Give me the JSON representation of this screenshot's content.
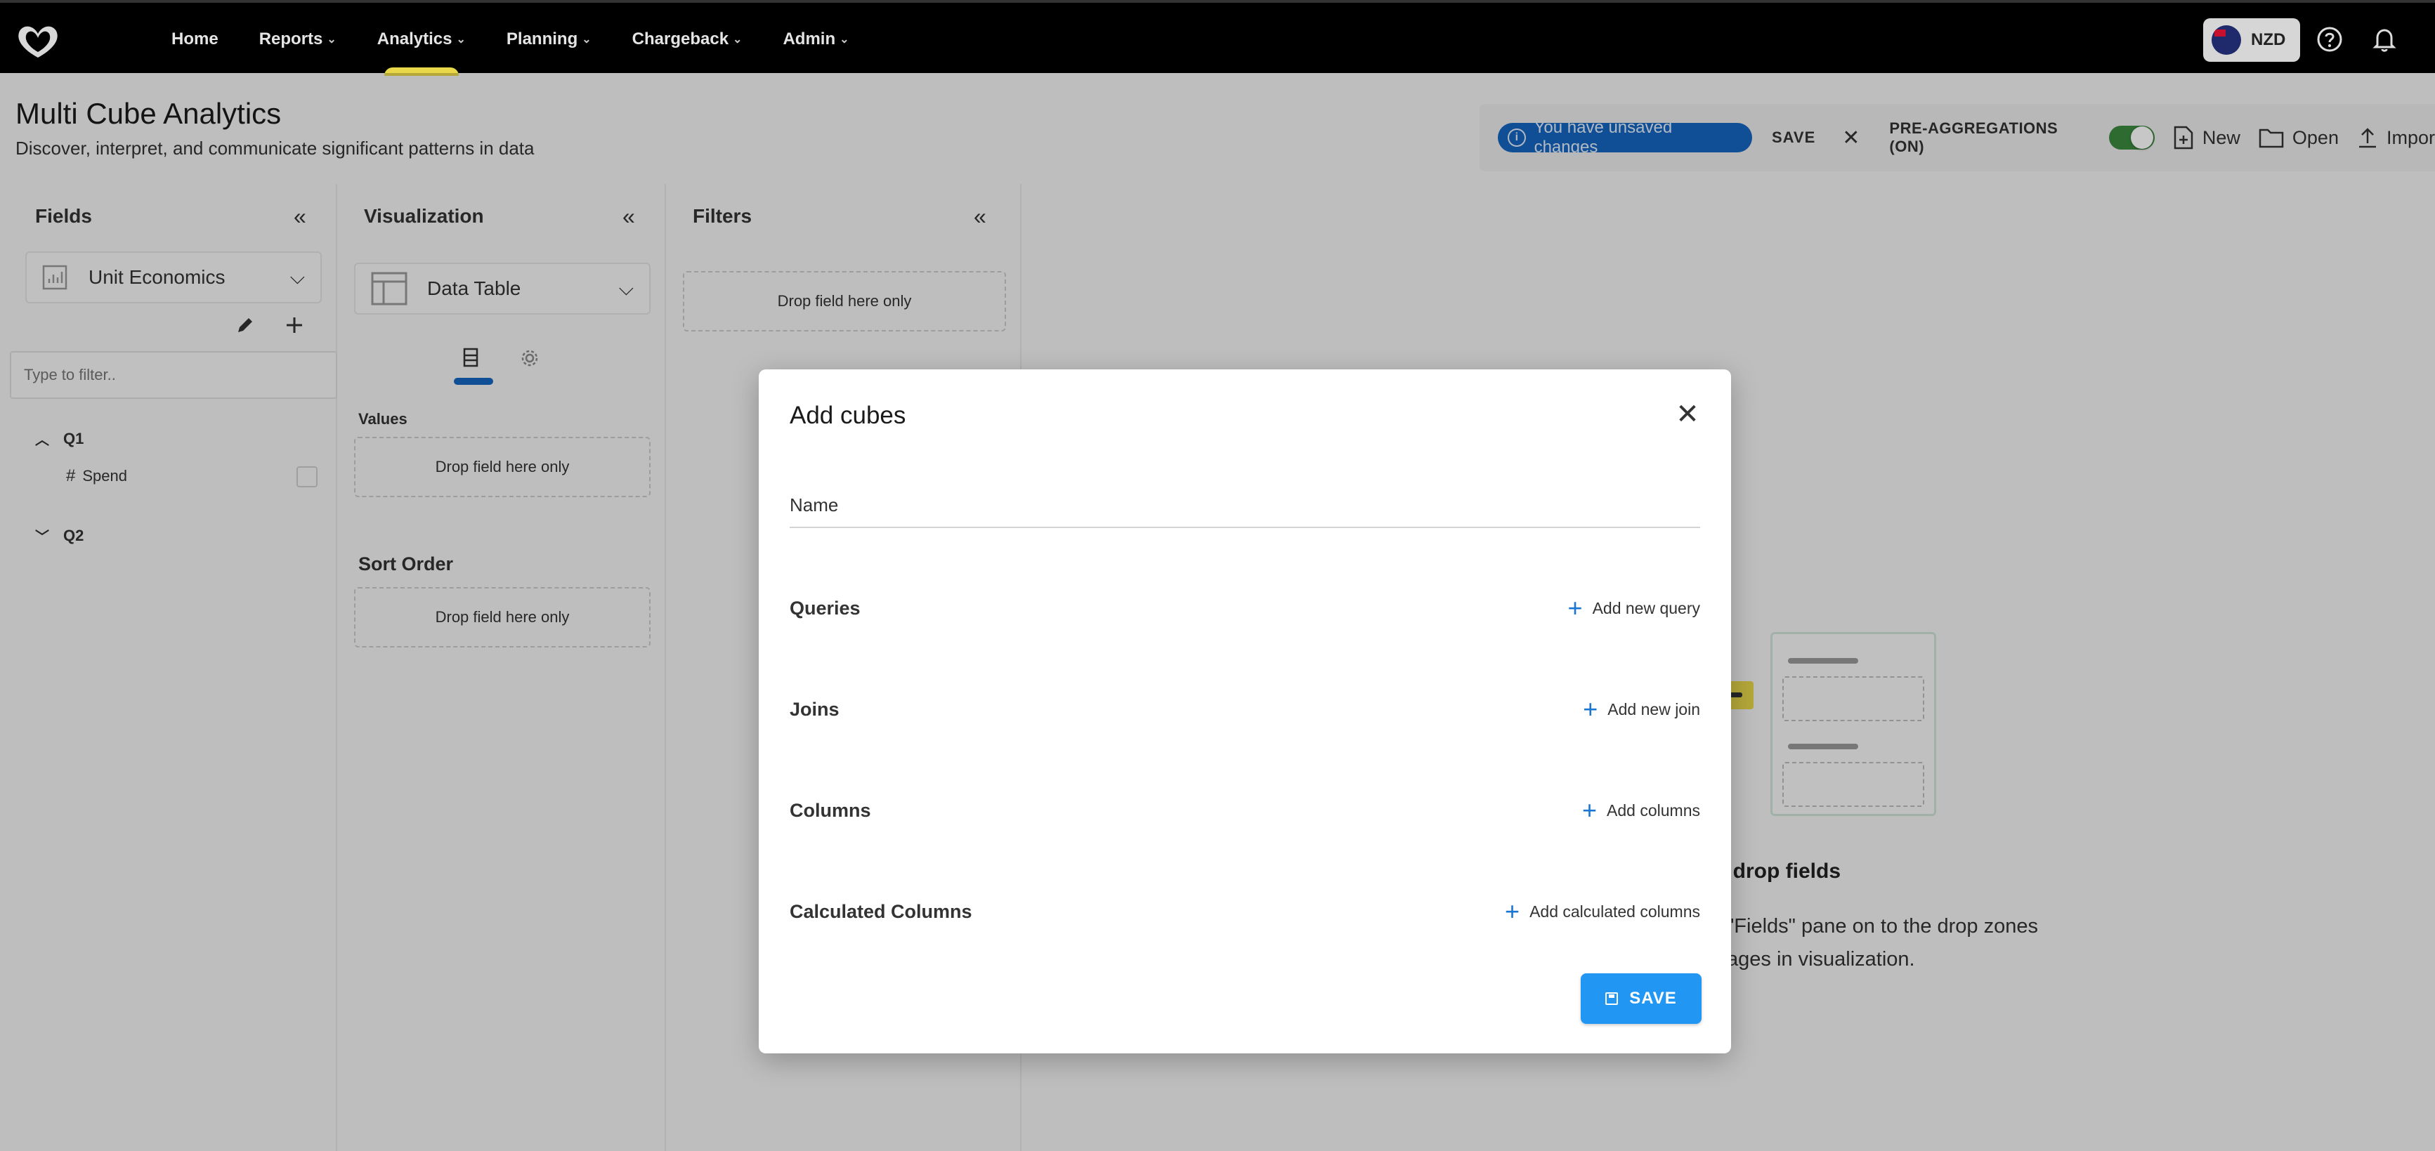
{
  "nav": {
    "items": [
      {
        "label": "Home",
        "has_menu": false,
        "active": false
      },
      {
        "label": "Reports",
        "has_menu": true,
        "active": false
      },
      {
        "label": "Analytics",
        "has_menu": true,
        "active": true
      },
      {
        "label": "Planning",
        "has_menu": true,
        "active": false
      },
      {
        "label": "Chargeback",
        "has_menu": true,
        "active": false
      },
      {
        "label": "Admin",
        "has_menu": true,
        "active": false
      }
    ],
    "currency": "NZD"
  },
  "header": {
    "title": "Multi Cube Analytics",
    "subtitle": "Discover, interpret, and communicate significant patterns in data"
  },
  "actionbar": {
    "unsaved_text": "You have unsaved changes",
    "save_label": "SAVE",
    "preagg_label": "PRE-AGGREGATIONS (ON)",
    "preagg_on": true,
    "new_label": "New",
    "open_label": "Open",
    "import_label": "Impor"
  },
  "fields_panel": {
    "title": "Fields",
    "cube_select": "Unit Economics",
    "filter_placeholder": "Type to filter..",
    "tree": [
      {
        "group": "Q1",
        "expanded": true,
        "fields": [
          {
            "name": "Spend",
            "type": "#"
          }
        ]
      },
      {
        "group": "Q2",
        "expanded": false,
        "fields": []
      }
    ]
  },
  "visualization_panel": {
    "title": "Visualization",
    "type_select": "Data Table",
    "values_label": "Values",
    "values_drop": "Drop field here only",
    "sort_label": "Sort Order",
    "sort_drop": "Drop field here only"
  },
  "filters_panel": {
    "title": "Filters",
    "drop": "Drop field here only"
  },
  "empty_state": {
    "title": "d drop fields",
    "line1": "\"Fields\" pane on to the drop zones",
    "line2": "ages in visualization."
  },
  "modal": {
    "title": "Add cubes",
    "name_label": "Name",
    "sections": [
      {
        "label": "Queries",
        "action": "Add new query"
      },
      {
        "label": "Joins",
        "action": "Add new join"
      },
      {
        "label": "Columns",
        "action": "Add columns"
      },
      {
        "label": "Calculated Columns",
        "action": "Add calculated columns"
      }
    ],
    "save_label": "SAVE"
  },
  "colors": {
    "accent_blue": "#2196f3",
    "nav_active": "#e8d84a",
    "toggle_on": "#3a8a3e",
    "pill_blue": "#1565c0"
  }
}
